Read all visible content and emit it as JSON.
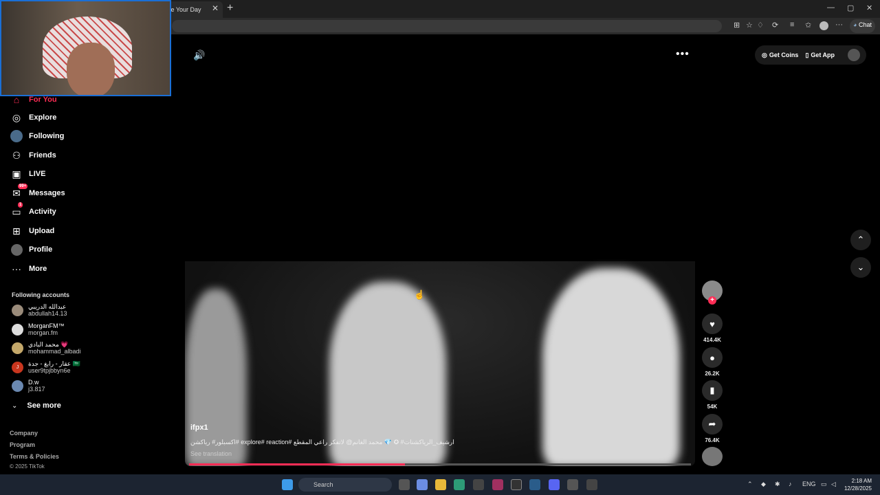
{
  "browser": {
    "tab_title": "ke Your Day",
    "tab_close": "✕",
    "new_tab": "+",
    "window_controls": {
      "minimize": "—",
      "maximize": "▢",
      "close": "✕"
    },
    "toolbar_icons": [
      "grid-icon",
      "star-icon",
      "bell-icon",
      "extensions-icon",
      "reading-list-icon",
      "favorites-icon",
      "profile-icon",
      "menu-icon"
    ],
    "chat_label": "Chat"
  },
  "sidebar": {
    "items": [
      {
        "label": "For You",
        "icon": "home-icon",
        "active": true
      },
      {
        "label": "Explore",
        "icon": "compass-icon"
      },
      {
        "label": "Following",
        "icon": "following-icon"
      },
      {
        "label": "Friends",
        "icon": "friends-icon"
      },
      {
        "label": "LIVE",
        "icon": "live-icon"
      },
      {
        "label": "Messages",
        "icon": "messages-icon",
        "badge": "99+"
      },
      {
        "label": "Activity",
        "icon": "activity-icon",
        "badge": "1"
      },
      {
        "label": "Upload",
        "icon": "upload-icon"
      },
      {
        "label": "Profile",
        "icon": "profile-icon"
      },
      {
        "label": "More",
        "icon": "more-icon"
      }
    ],
    "following_title": "Following accounts",
    "accounts": [
      {
        "name": "عبدالله الدريبي",
        "user": "abdullah14.13"
      },
      {
        "name": "MorganFM™",
        "user": "morgan.fm"
      },
      {
        "name": "محمد البادي 💗",
        "user": "mohammad_albadi"
      },
      {
        "name": "عقار - رابغ - جدة 🇸🇦",
        "user": "user9tpjbbyn6e",
        "initial": "J"
      },
      {
        "name": "D.w",
        "user": "j3.817"
      }
    ],
    "see_more": "See more",
    "footer": [
      "Company",
      "Program",
      "Terms & Policies",
      "© 2025 TikTok"
    ]
  },
  "video": {
    "author": "ifpx1",
    "caption": "اكسبلور# رياكشن# explore# reaction# ارشيف_الرياكشنات# ✪ 💎 محمد الغانم@ لاتفكر راعي المقطع",
    "see_translation": "See translation",
    "progress": 0.43
  },
  "actions": {
    "likes": "414.4K",
    "comments": "26.2K",
    "saves": "54K",
    "shares": "76.4K"
  },
  "topbar": {
    "get_coins": "Get Coins",
    "get_app": "Get App"
  },
  "taskbar": {
    "search_placeholder": "Search",
    "language": "ENG",
    "time": "2:18 AM",
    "date": "12/28/2025"
  },
  "colors": {
    "accent": "#fe2c55",
    "taskbar": "#1c2431"
  }
}
